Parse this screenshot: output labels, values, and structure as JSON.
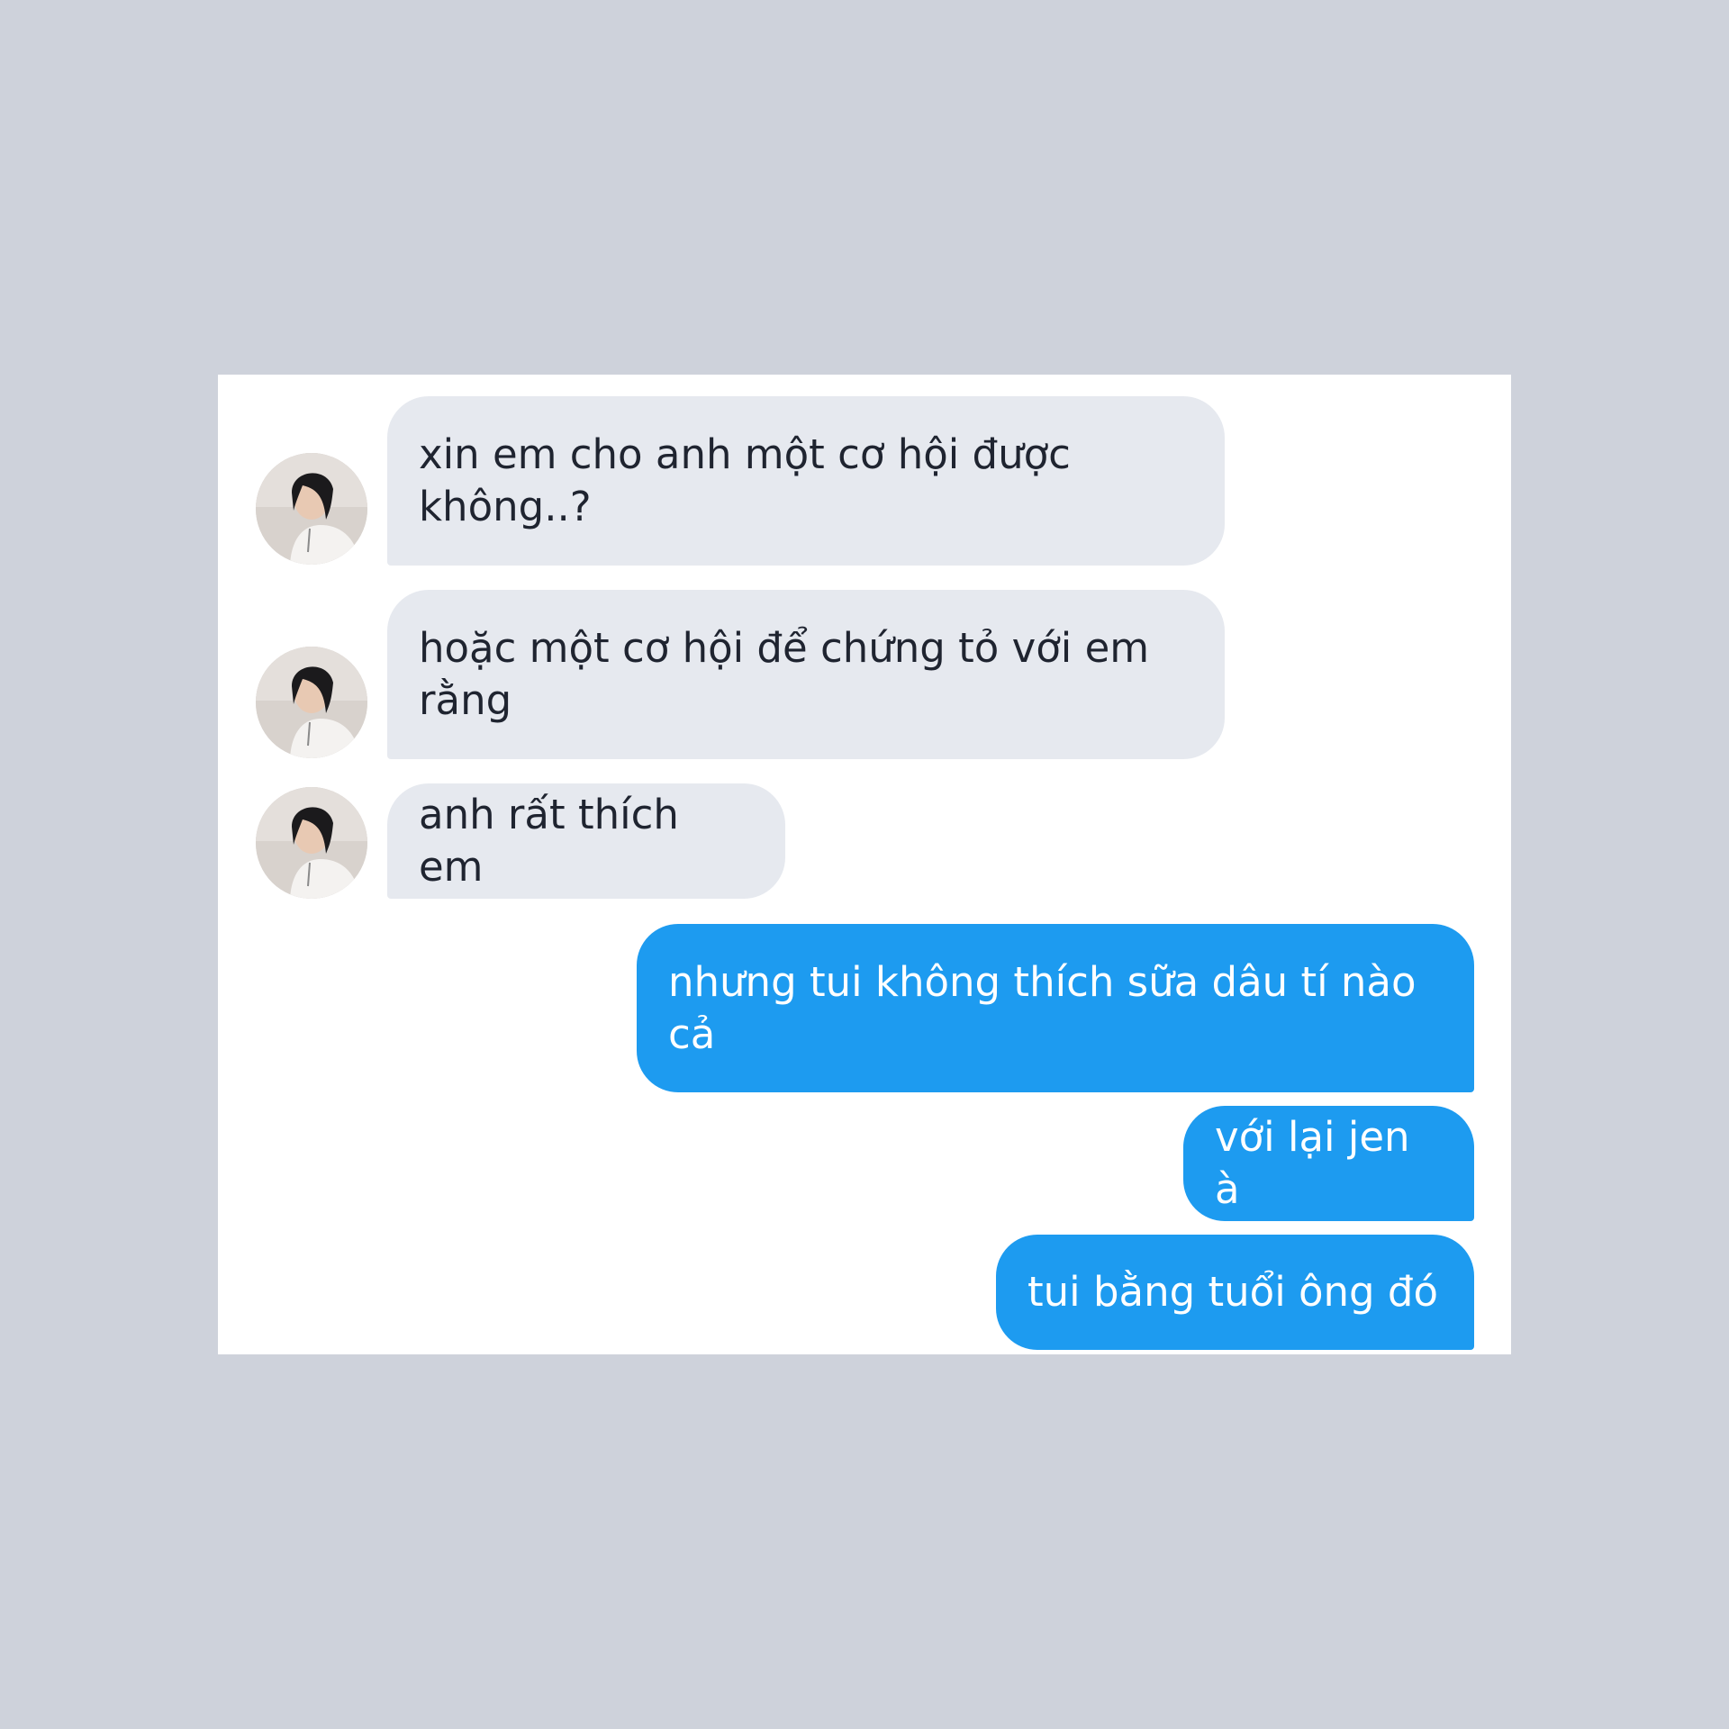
{
  "conversation": {
    "messages": [
      {
        "sender": "other",
        "text": "xin em cho anh một cơ hội được không..?"
      },
      {
        "sender": "other",
        "text": "hoặc một cơ hội để chứng tỏ với em rằng"
      },
      {
        "sender": "other",
        "text": "anh rất thích em"
      },
      {
        "sender": "me",
        "text": "nhưng tui không thích sữa dâu tí nào cả"
      },
      {
        "sender": "me",
        "text": "với lại jen à"
      },
      {
        "sender": "me",
        "text": "tui bằng tuổi ông đó"
      }
    ]
  },
  "colors": {
    "background": "#ced2db",
    "received_bubble": "#e6e9ef",
    "sent_bubble": "#1d9bf0"
  },
  "icons": {
    "avatar": "profile-photo"
  }
}
